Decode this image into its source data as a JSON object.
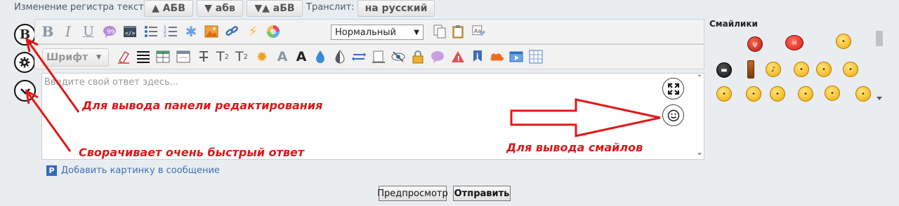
{
  "topbar": {
    "case_label": "Изменение регистра текста:",
    "upper_btn": "▲ АБВ",
    "lower_btn": "▼ абв",
    "invert_btn": "▼▲ аБВ",
    "translit_label": "Транслит:",
    "translit_btn": "на русский"
  },
  "toolbar": {
    "format_value": "Нормальный",
    "font_btn": "Шрифт"
  },
  "editor": {
    "placeholder": "Введите свой ответ здесь..."
  },
  "annotations": {
    "edit_panel": "Для вывода панели редактирования",
    "collapse": "Сворачивает очень быстрый ответ",
    "smilies": "Для вывода смайлов"
  },
  "attach": {
    "add_picture": "Добавить картинку в сообщение"
  },
  "actions": {
    "preview": "Предпросмотр",
    "submit": "Отправить"
  },
  "smilies": {
    "title": "Смайлики"
  },
  "colors": {
    "annotation": "#d61a1a",
    "link": "#3a6fb6"
  }
}
